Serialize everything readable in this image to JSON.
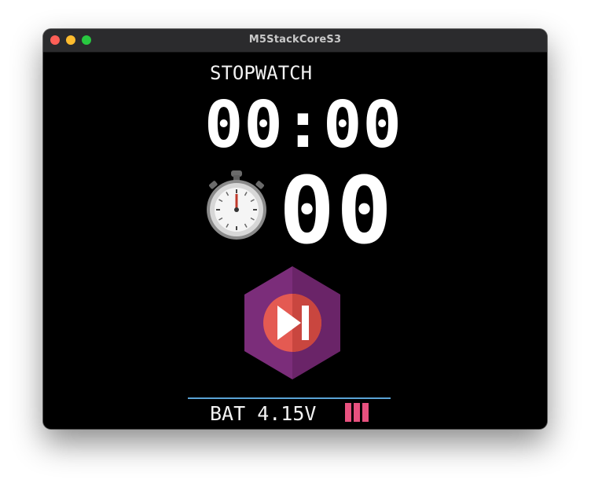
{
  "window": {
    "title": "M5StackCoreS3"
  },
  "screen": {
    "label": "STOPWATCH",
    "timer": "00:00",
    "seconds": "00",
    "battery_label": "BAT 4.15V",
    "battery_level_bars": 3
  },
  "icons": {
    "stopwatch": "stopwatch-icon",
    "skip": "skip-forward-icon"
  },
  "colors": {
    "background": "#000000",
    "text": "#ffffff",
    "divider": "#5aa3d6",
    "battery_bar": "#e8517f",
    "hex_button": "#7a2f79",
    "circle_button": "#e55a52"
  }
}
